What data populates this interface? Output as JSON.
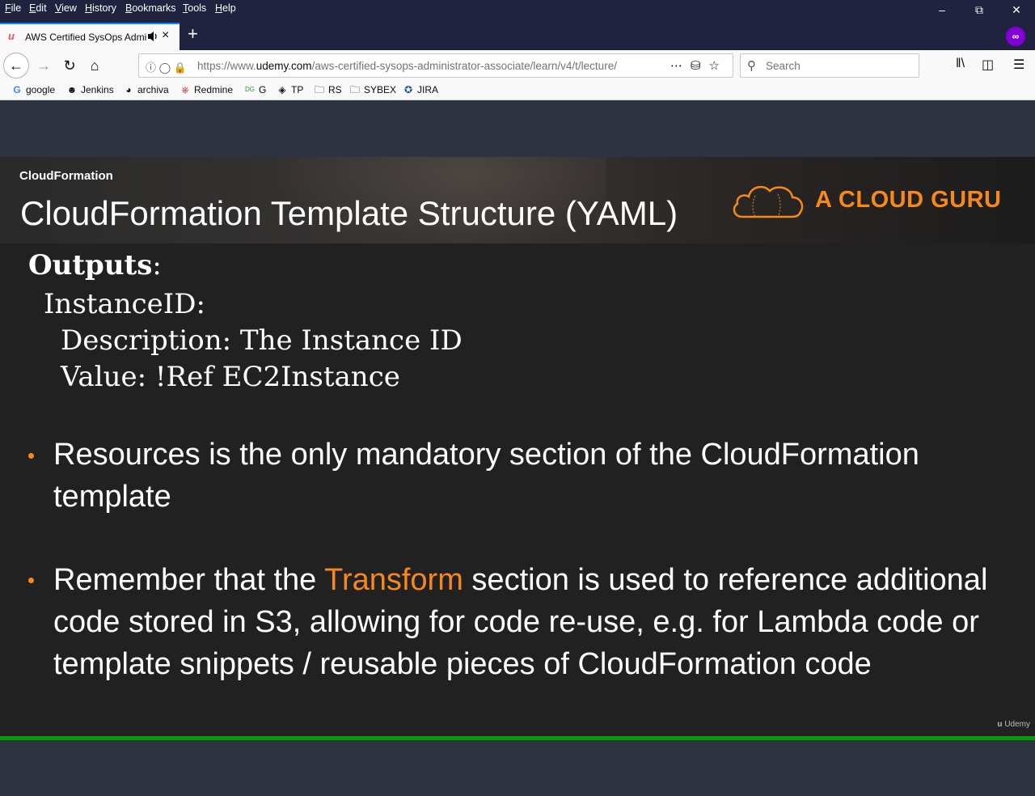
{
  "browser": {
    "menu": [
      "File",
      "Edit",
      "View",
      "History",
      "Bookmarks",
      "Tools",
      "Help"
    ],
    "tab_title": "AWS Certified SysOps Administrator - Associate",
    "url_prefix": "https://www.",
    "url_domain": "udemy.com",
    "url_path": "/aws-certified-sysops-administrator-associate/learn/v4/t/lecture/",
    "search_placeholder": "Search",
    "bookmarks": [
      "google",
      "Jenkins",
      "archiva",
      "Redmine",
      "G",
      "TP",
      "RS",
      "SYBEX",
      "JIRA"
    ]
  },
  "slide": {
    "section": "CloudFormation",
    "title": "CloudFormation Template Structure (YAML)",
    "brand": "A CLOUD GURU",
    "code": {
      "outputs": "Outputs",
      "colon": ":",
      "instance_id": "InstanceID:",
      "description": "Description: The Instance ID",
      "value": "Value: !Ref EC2Instance"
    },
    "bullet1": "Resources is the only mandatory section of the CloudFormation template",
    "bullet2_before": "Remember that the ",
    "bullet2_highlight": "Transform",
    "bullet2_after": " section is used to reference additional code stored in S3, allowing for code re-use, e.g. for Lambda code or template snippets / reusable pieces of CloudFormation code",
    "watermark": "Udemy"
  },
  "player": {
    "progress_percent": 100
  },
  "colors": {
    "accent": "#f7881c",
    "progress": "#0a9b0a",
    "slide_bg": "#212121",
    "page_bg": "#2d3440"
  }
}
